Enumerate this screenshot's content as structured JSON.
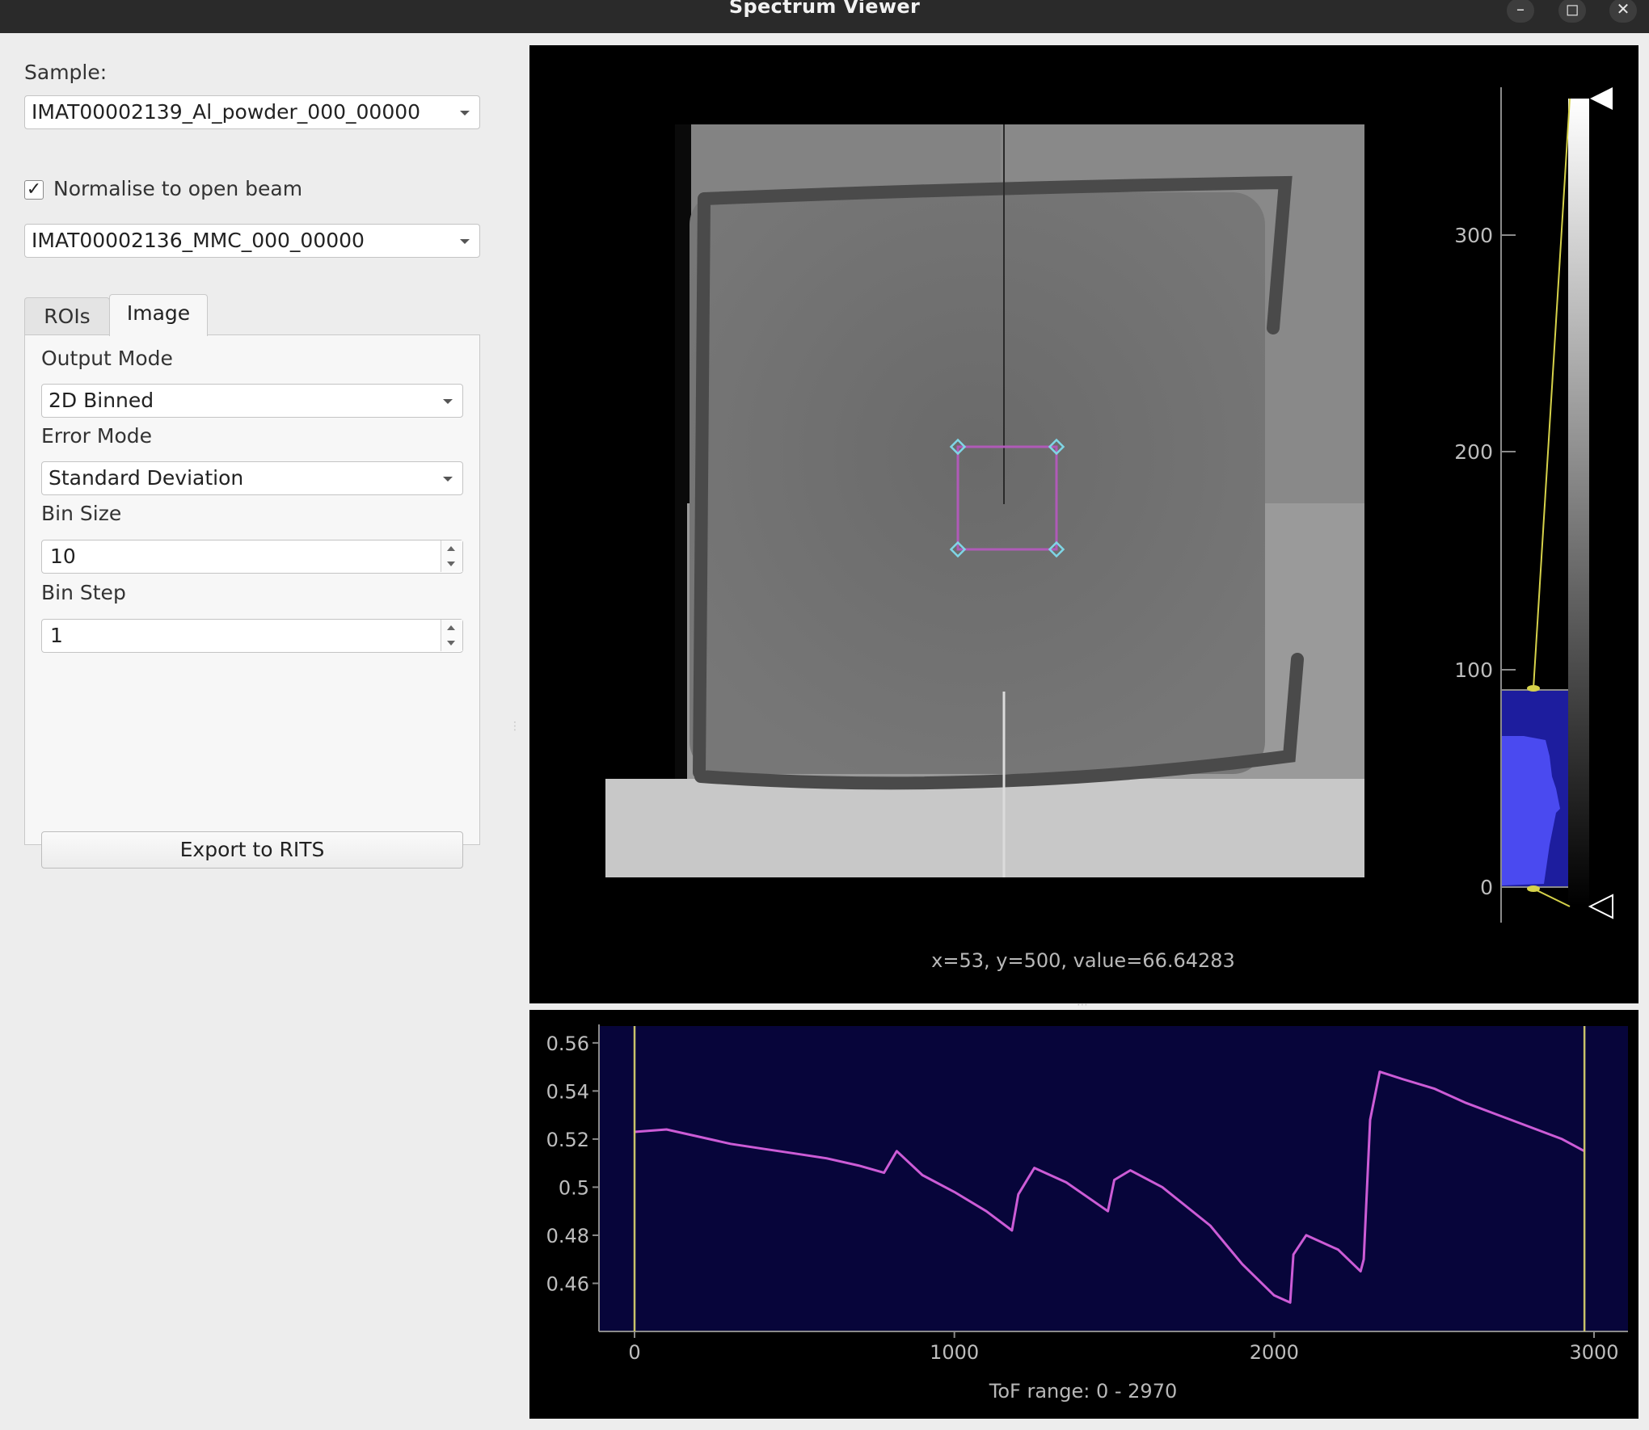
{
  "window": {
    "title": "Spectrum Viewer"
  },
  "sample": {
    "label": "Sample:",
    "value": "IMAT00002139_Al_powder_000_00000"
  },
  "normalise": {
    "label": "Normalise to open beam",
    "checked": true,
    "value": "IMAT00002136_MMC_000_00000"
  },
  "tabs": [
    {
      "label": "ROIs",
      "active": false
    },
    {
      "label": "Image",
      "active": true
    }
  ],
  "image_tab": {
    "output_mode_label": "Output Mode",
    "output_mode_value": "2D Binned",
    "error_mode_label": "Error Mode",
    "error_mode_value": "Standard Deviation",
    "bin_size_label": "Bin Size",
    "bin_size_value": "10",
    "bin_step_label": "Bin Step",
    "bin_step_value": "1",
    "export_label": "Export to RITS"
  },
  "image_view": {
    "status": "x=53, y=500, value=66.64283",
    "histogram_ticks": [
      "300",
      "200",
      "100",
      "0"
    ],
    "colors": {
      "background": "#000000",
      "roi": "#b05ab8",
      "roi_handle": "#7fd6e6",
      "histogram_fill": "#2f2fd6",
      "level_line": "#d6d24a"
    }
  },
  "spectrum_plot": {
    "range_label": "ToF range: 0 - 2970",
    "x_ticks": [
      "0",
      "1000",
      "2000",
      "3000"
    ],
    "y_ticks": [
      "0.56",
      "0.54",
      "0.52",
      "0.5",
      "0.48",
      "0.46"
    ],
    "colors": {
      "background": "#07053a",
      "line": "#cc5cd6",
      "region_line": "#c8c26a"
    }
  },
  "chart_data": {
    "type": "line",
    "xlim": [
      0,
      2970
    ],
    "ylim": [
      0.44,
      0.567
    ],
    "grid": false,
    "x": [
      0,
      100,
      200,
      300,
      400,
      500,
      600,
      700,
      780,
      820,
      900,
      1000,
      1100,
      1180,
      1200,
      1250,
      1350,
      1480,
      1500,
      1550,
      1650,
      1800,
      1900,
      2000,
      2050,
      2060,
      2100,
      2200,
      2270,
      2280,
      2300,
      2330,
      2400,
      2500,
      2600,
      2700,
      2800,
      2900,
      2970
    ],
    "y": [
      0.523,
      0.524,
      0.521,
      0.518,
      0.516,
      0.514,
      0.512,
      0.509,
      0.506,
      0.515,
      0.505,
      0.498,
      0.49,
      0.482,
      0.497,
      0.508,
      0.502,
      0.49,
      0.503,
      0.507,
      0.5,
      0.484,
      0.468,
      0.455,
      0.452,
      0.472,
      0.48,
      0.474,
      0.465,
      0.47,
      0.528,
      0.548,
      0.545,
      0.541,
      0.535,
      0.53,
      0.525,
      0.52,
      0.515
    ]
  }
}
